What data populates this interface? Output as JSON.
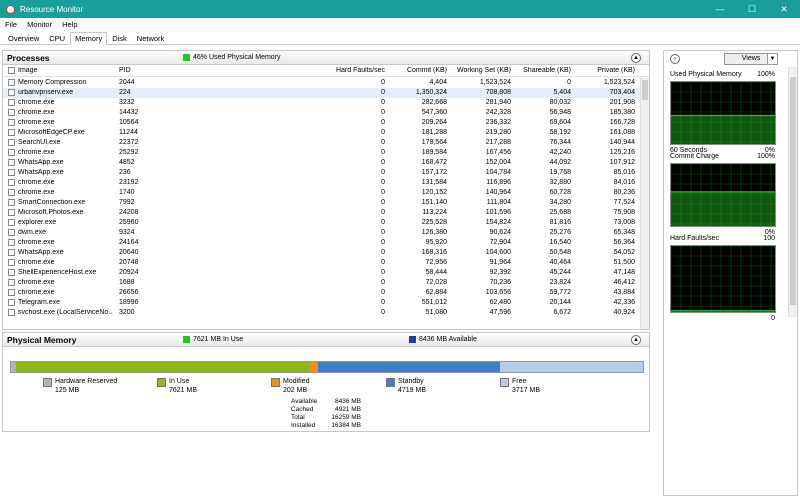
{
  "window": {
    "title": "Resource Monitor",
    "minimize": "—",
    "maximize": "☐",
    "close": "✕"
  },
  "menu": [
    "File",
    "Monitor",
    "Help"
  ],
  "tabs": [
    "Overview",
    "CPU",
    "Memory",
    "Disk",
    "Network"
  ],
  "processes": {
    "title": "Processes",
    "used_label": "46% Used Physical Memory",
    "columns": {
      "image": "Image",
      "pid": "PID",
      "hard_faults": "Hard Faults/sec",
      "commit": "Commit (KB)",
      "working_set": "Working Set (KB)",
      "shareable": "Shareable (KB)",
      "private": "Private (KB)"
    },
    "rows": [
      [
        "Memory Compression",
        "2044",
        "0",
        "4,404",
        "1,523,524",
        "0",
        "1,523,524"
      ],
      [
        "urbanvpnserv.exe",
        "224",
        "0",
        "1,350,324",
        "708,808",
        "5,404",
        "703,404"
      ],
      [
        "chrome.exe",
        "3232",
        "0",
        "282,668",
        "281,940",
        "80,032",
        "201,908"
      ],
      [
        "chrome.exe",
        "14432",
        "0",
        "547,360",
        "242,328",
        "56,948",
        "185,380"
      ],
      [
        "chrome.exe",
        "10564",
        "0",
        "209,264",
        "236,332",
        "69,604",
        "166,728"
      ],
      [
        "MicrosoftEdgeCP.exe",
        "11244",
        "0",
        "181,288",
        "219,280",
        "58,192",
        "161,088"
      ],
      [
        "SearchUI.exe",
        "22372",
        "0",
        "178,564",
        "217,288",
        "76,344",
        "140,944"
      ],
      [
        "chrome.exe",
        "25292",
        "0",
        "189,584",
        "167,456",
        "42,240",
        "125,216"
      ],
      [
        "WhatsApp.exe",
        "4852",
        "0",
        "168,472",
        "152,004",
        "44,092",
        "107,912"
      ],
      [
        "WhatsApp.exe",
        "236",
        "0",
        "157,172",
        "104,784",
        "19,768",
        "85,016"
      ],
      [
        "chrome.exe",
        "23192",
        "0",
        "131,584",
        "116,896",
        "32,880",
        "84,016"
      ],
      [
        "chrome.exe",
        "1740",
        "0",
        "120,152",
        "140,964",
        "60,728",
        "80,236"
      ],
      [
        "SmartConnection.exe",
        "7992",
        "0",
        "151,140",
        "111,804",
        "34,280",
        "77,524"
      ],
      [
        "Microsoft.Photos.exe",
        "24208",
        "0",
        "113,224",
        "101,596",
        "25,688",
        "75,908"
      ],
      [
        "explorer.exe",
        "25960",
        "0",
        "225,528",
        "154,824",
        "81,816",
        "73,008"
      ],
      [
        "dwm.exe",
        "9324",
        "0",
        "126,380",
        "90,624",
        "25,276",
        "65,348"
      ],
      [
        "chrome.exe",
        "24164",
        "0",
        "95,920",
        "72,904",
        "16,540",
        "56,364"
      ],
      [
        "WhatsApp.exe",
        "20640",
        "0",
        "168,316",
        "104,600",
        "50,548",
        "54,052"
      ],
      [
        "chrome.exe",
        "20748",
        "0",
        "72,956",
        "91,964",
        "40,464",
        "51,500"
      ],
      [
        "ShellExperienceHost.exe",
        "20924",
        "0",
        "58,444",
        "92,392",
        "45,244",
        "47,148"
      ],
      [
        "chrome.exe",
        "1688",
        "0",
        "72,028",
        "70,236",
        "23,824",
        "46,412"
      ],
      [
        "chrome.exe",
        "26656",
        "0",
        "62,884",
        "103,656",
        "59,772",
        "43,884"
      ],
      [
        "Telegram.exe",
        "18996",
        "0",
        "551,012",
        "62,480",
        "20,144",
        "42,336"
      ],
      [
        "svchost.exe (LocalServiceNo...",
        "3200",
        "0",
        "51,080",
        "47,596",
        "6,672",
        "40,924"
      ]
    ]
  },
  "physical_memory": {
    "title": "Physical Memory",
    "in_use_label": "7621 MB In Use",
    "available_label": "8436 MB Available",
    "bar_fractions": {
      "hardware_reserved": 0.0076,
      "in_use": 0.4653,
      "modified": 0.0123,
      "standby": 0.2881,
      "free": 0.2269
    },
    "legend": [
      {
        "name": "Hardware Reserved",
        "value": "125 MB",
        "color": "#b4b4b4"
      },
      {
        "name": "In Use",
        "value": "7621 MB",
        "color": "#8db717"
      },
      {
        "name": "Modified",
        "value": "202 MB",
        "color": "#f0901a"
      },
      {
        "name": "Standby",
        "value": "4719 MB",
        "color": "#3f7ec8"
      },
      {
        "name": "Free",
        "value": "3717 MB",
        "color": "#b3cdea"
      }
    ],
    "stats": [
      {
        "label": "Available",
        "value": "8436 MB"
      },
      {
        "label": "Cached",
        "value": "4921 MB"
      },
      {
        "label": "Total",
        "value": "16259 MB"
      },
      {
        "label": "Installed",
        "value": "16384 MB"
      }
    ]
  },
  "side": {
    "views_label": "Views",
    "graphs": [
      {
        "title": "Used Physical Memory",
        "max": "100%",
        "footer_left": "60 Seconds",
        "footer_right": "0%",
        "level": 0.46
      },
      {
        "title": "Commit Charge",
        "max": "100%",
        "footer_left": "",
        "footer_right": "0%",
        "level": 0.55
      },
      {
        "title": "Hard Faults/sec",
        "max": "100",
        "footer_left": "",
        "footer_right": "0",
        "level": 0.02
      }
    ]
  },
  "colors": {
    "title_bar": "#1a9e9b",
    "graph_green": "#23c423",
    "highlight_row": "#e3eefb"
  }
}
